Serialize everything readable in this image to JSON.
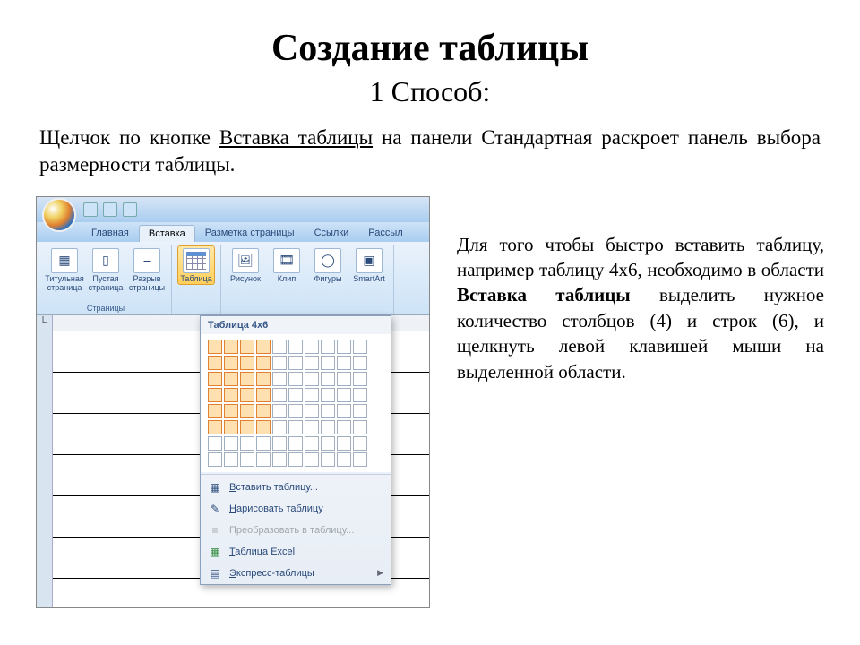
{
  "title": "Создание таблицы",
  "subtitle": "1 Способ:",
  "intro_1": "Щелчок по кнопке ",
  "intro_u": "Вставка таблицы",
  "intro_2": " на панели Стандартная раскроет панель выбора размерности таблицы.",
  "desc_1": "Для того чтобы быстро вставить таблицу, например таблицу 4х6, необходимо в области ",
  "desc_b": "Вставка таблицы",
  "desc_2": " выделить нужное количество столбцов (4) и строк (6), и щелкнуть левой клавишей мыши на выделенной области.",
  "tabs": [
    "Главная",
    "Вставка",
    "Разметка страницы",
    "Ссылки",
    "Рассыл"
  ],
  "active_tab": 1,
  "group_pages": "Страницы",
  "btn_cover": "Титульная страница",
  "btn_blank": "Пустая страница",
  "btn_break": "Разрыв страницы",
  "btn_table": "Таблица",
  "btn_picture": "Рисунок",
  "btn_clip": "Клип",
  "btn_shapes": "Фигуры",
  "btn_smartart": "SmartArt",
  "dd_title": "Таблица 4x6",
  "dd_insert": "Вставить таблицу...",
  "dd_draw": "Нарисовать таблицу",
  "dd_convert": "Преобразовать в таблицу...",
  "dd_excel": "Таблица Excel",
  "dd_quick": "Экспресс-таблицы",
  "grid": {
    "rows": 8,
    "cols": 10,
    "sel_rows": 6,
    "sel_cols": 4
  },
  "ruler_label": "L"
}
